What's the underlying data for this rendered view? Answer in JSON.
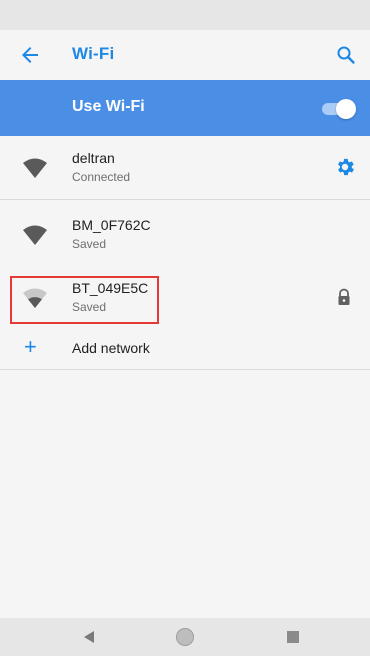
{
  "app_bar": {
    "title": "Wi-Fi",
    "back_icon": "arrow-left-icon",
    "search_icon": "search-icon"
  },
  "master_switch": {
    "label": "Use Wi-Fi",
    "state": "on"
  },
  "networks": [
    {
      "name": "deltran",
      "status": "Connected",
      "signal": "full",
      "action_icon": "gear-icon"
    },
    {
      "name": "BM_0F762C",
      "status": "Saved",
      "signal": "full",
      "action_icon": ""
    },
    {
      "name": "BT_049E5C",
      "status": "Saved",
      "signal": "weak",
      "action_icon": "lock-icon"
    }
  ],
  "add_network": {
    "label": "Add network",
    "icon": "plus-icon"
  },
  "colors": {
    "accent": "#1e88e5",
    "switch_bar": "#4a8ee6",
    "highlight": "#e53935"
  }
}
